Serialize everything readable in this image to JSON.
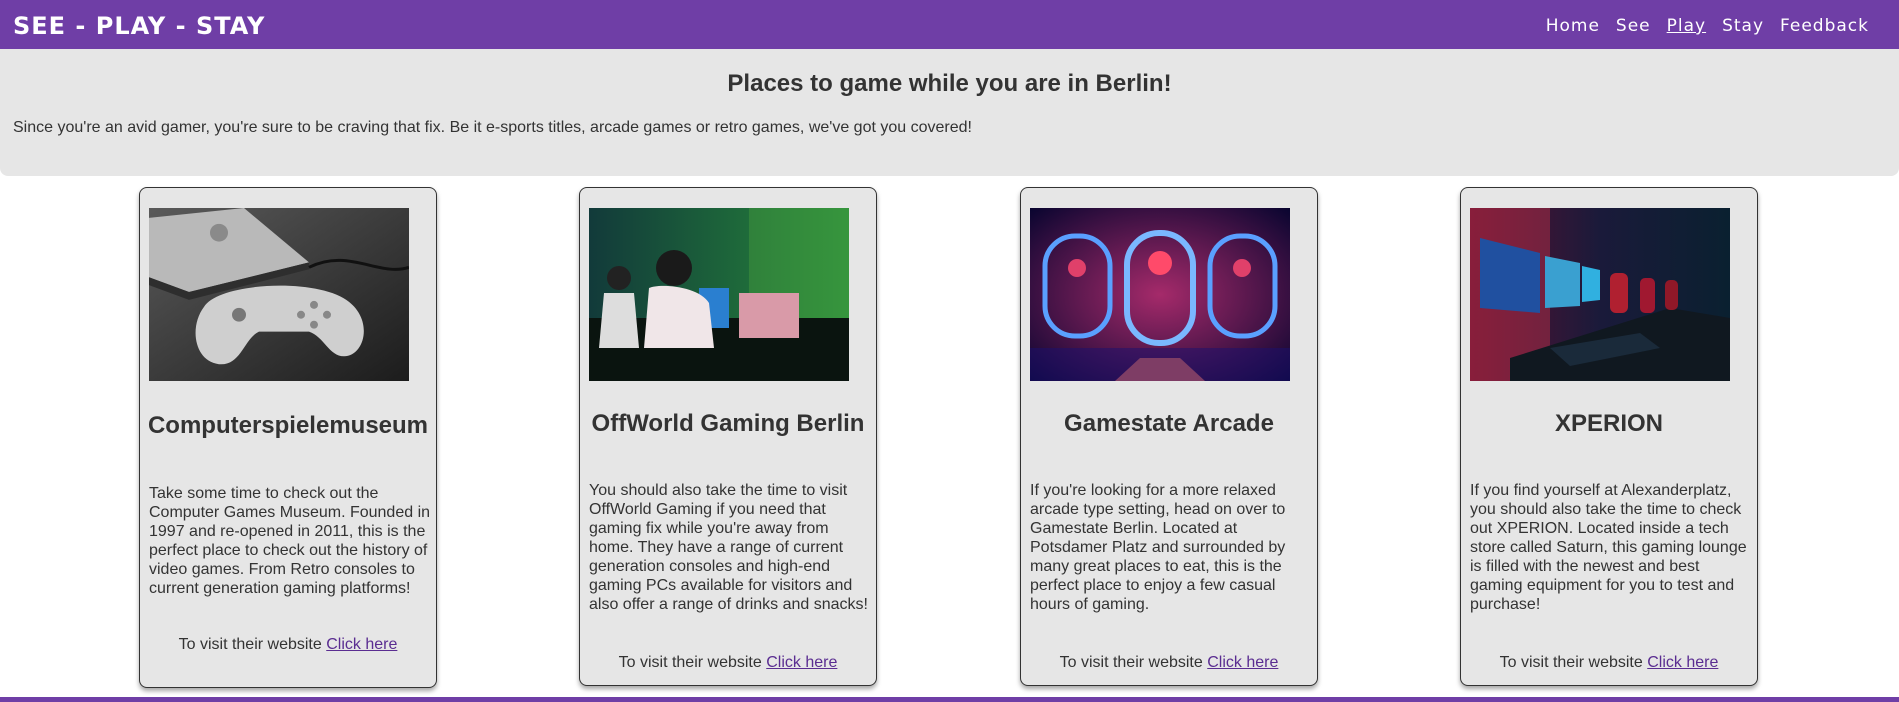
{
  "header": {
    "brand": "SEE - PLAY - STAY",
    "nav": [
      "Home",
      "See",
      "Play",
      "Stay",
      "Feedback"
    ],
    "active_nav": "Play",
    "accent_color": "#6f3ea6"
  },
  "intro": {
    "title": "Places to game while you are in Berlin!",
    "text": "Since you're an avid gamer, you're sure to be craving that fix. Be it e-sports titles, arcade games or retro games, we've got you covered!"
  },
  "cards": [
    {
      "title": "Computerspielemuseum",
      "image": "playstation-controller-photo",
      "text": "Take some time to check out the Computer Games Museum. Founded in 1997 and re-opened in 2011, this is the perfect place to check out the history of video games. From Retro consoles to current generation gaming platforms!",
      "visit_text": "To visit their website",
      "link_text": "Click here"
    },
    {
      "title": "OffWorld Gaming Berlin",
      "image": "gamers-at-pcs-photo",
      "text": "You should also take the time to visit OffWorld Gaming if you need that gaming fix while you're away from home. They have a range of current generation consoles and high-end gaming PCs available for visitors and also offer a range of drinks and snacks!",
      "visit_text": "To visit their website",
      "link_text": "Click here"
    },
    {
      "title": "Gamestate Arcade",
      "image": "neon-basketball-arcade-photo",
      "text": "If you're looking for a more relaxed arcade type setting, head on over to Gamestate Berlin. Located at Potsdamer Platz and surrounded by many great places to eat, this is the perfect place to enjoy a few casual hours of gaming.",
      "visit_text": "To visit their website",
      "link_text": "Click here"
    },
    {
      "title": "XPERION",
      "image": "gaming-lounge-photo",
      "text": "If you find yourself at Alexanderplatz, you should also take the time to check out XPERION. Located inside a tech store called Saturn, this gaming lounge is filled with the newest and best gaming equipment for you to test and purchase!",
      "visit_text": "To visit their website",
      "link_text": "Click here"
    }
  ]
}
